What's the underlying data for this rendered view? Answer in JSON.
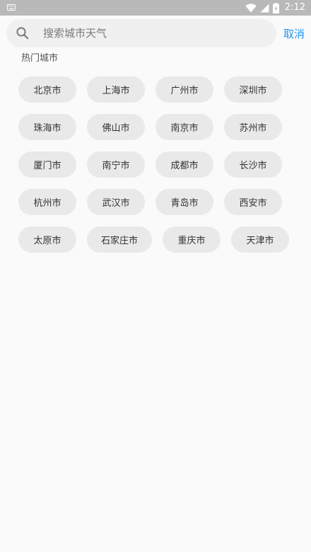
{
  "status_bar": {
    "time": "2:12",
    "icons": [
      "keyboard-icon",
      "wifi-icon",
      "signal-icon",
      "battery-icon"
    ]
  },
  "search": {
    "placeholder": "搜索城市天气",
    "value": "",
    "cancel_label": "取消"
  },
  "hot_cities": {
    "title": "热门城市",
    "rows": [
      [
        "北京市",
        "上海市",
        "广州市",
        "深圳市"
      ],
      [
        "珠海市",
        "佛山市",
        "南京市",
        "苏州市"
      ],
      [
        "厦门市",
        "南宁市",
        "成都市",
        "长沙市"
      ],
      [
        "杭州市",
        "武汉市",
        "青岛市",
        "西安市"
      ],
      [
        "太原市",
        "石家庄市",
        "重庆市",
        "天津市"
      ]
    ]
  },
  "colors": {
    "accent": "#2196f3",
    "status_bar": "#b9b9b9",
    "chip_bg": "#e9e9e9",
    "background": "#fafafa"
  }
}
